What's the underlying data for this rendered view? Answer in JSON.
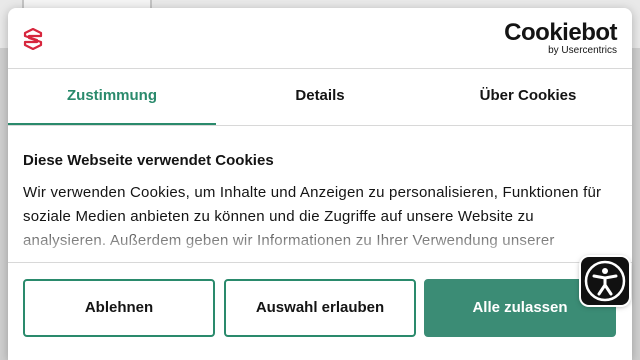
{
  "brand": {
    "name": "Cookiebot",
    "sub": "by Usercentrics"
  },
  "tabs": [
    {
      "label": "Zustimmung",
      "active": true
    },
    {
      "label": "Details",
      "active": false
    },
    {
      "label": "Über Cookies",
      "active": false
    }
  ],
  "content": {
    "title": "Diese Webseite verwendet Cookies",
    "body": "Wir verwenden Cookies, um Inhalte und Anzeigen zu personalisieren, Funktionen für soziale Medien anbieten zu können und die Zugriffe auf unsere Website zu analysieren. Außerdem geben wir Informationen zu Ihrer Verwendung unserer"
  },
  "buttons": {
    "decline": "Ablehnen",
    "allow_selection": "Auswahl erlauben",
    "allow_all": "Alle zulassen"
  },
  "colors": {
    "accent": "#2a8a6c",
    "primary_button": "#3b8c75",
    "logo": "#d7263d"
  },
  "icons": {
    "logo": "cookiebot-s-icon",
    "accessibility": "accessibility-icon"
  }
}
